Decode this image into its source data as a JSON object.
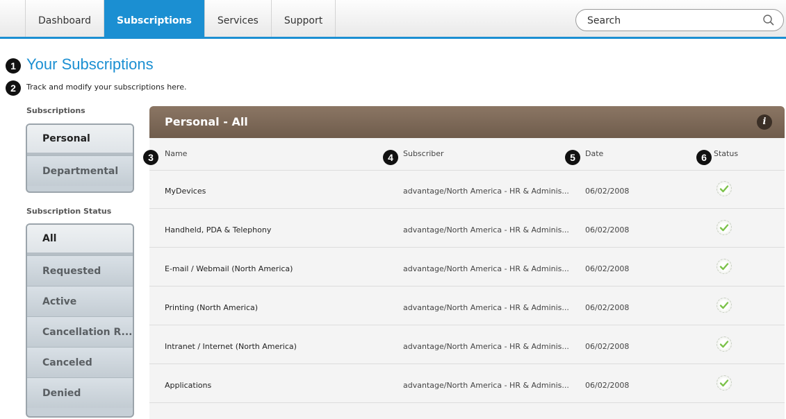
{
  "nav": {
    "tabs": [
      "Dashboard",
      "Subscriptions",
      "Services",
      "Support"
    ],
    "active_tab": "Subscriptions",
    "search_placeholder": "Search"
  },
  "page": {
    "title": "Your Subscriptions",
    "subtitle": "Track and modify your subscriptions here."
  },
  "callouts": [
    "1",
    "2",
    "3",
    "4",
    "5",
    "6"
  ],
  "sidebar": {
    "subscriptions_label": "Subscriptions",
    "subscription_types": [
      "Personal",
      "Departmental"
    ],
    "selected_type": "Personal",
    "status_label": "Subscription Status",
    "statuses": [
      "All",
      "Requested",
      "Active",
      "Cancellation R...",
      "Canceled",
      "Denied"
    ],
    "selected_status": "All"
  },
  "panel": {
    "title": "Personal - All",
    "info_icon": "info-icon",
    "columns": [
      "Name",
      "Subscriber",
      "Date",
      "Status"
    ],
    "rows": [
      {
        "name": "MyDevices",
        "subscriber": "advantage/North America - HR & Adminis...",
        "date": "06/02/2008",
        "status": "check-icon"
      },
      {
        "name": "Handheld, PDA & Telephony",
        "subscriber": "advantage/North America - HR & Adminis...",
        "date": "06/02/2008",
        "status": "check-icon"
      },
      {
        "name": "E-mail / Webmail (North America)",
        "subscriber": "advantage/North America - HR & Adminis...",
        "date": "06/02/2008",
        "status": "check-icon"
      },
      {
        "name": "Printing (North America)",
        "subscriber": "advantage/North America - HR & Adminis...",
        "date": "06/02/2008",
        "status": "check-icon"
      },
      {
        "name": "Intranet / Internet (North America)",
        "subscriber": "advantage/North America - HR & Adminis...",
        "date": "06/02/2008",
        "status": "check-icon"
      },
      {
        "name": "Applications",
        "subscriber": "advantage/North America - HR & Adminis...",
        "date": "06/02/2008",
        "status": "check-icon"
      }
    ]
  },
  "colors": {
    "accent": "#1b8fd2",
    "panel_header": "#7b6756",
    "check": "#7cc24a"
  }
}
